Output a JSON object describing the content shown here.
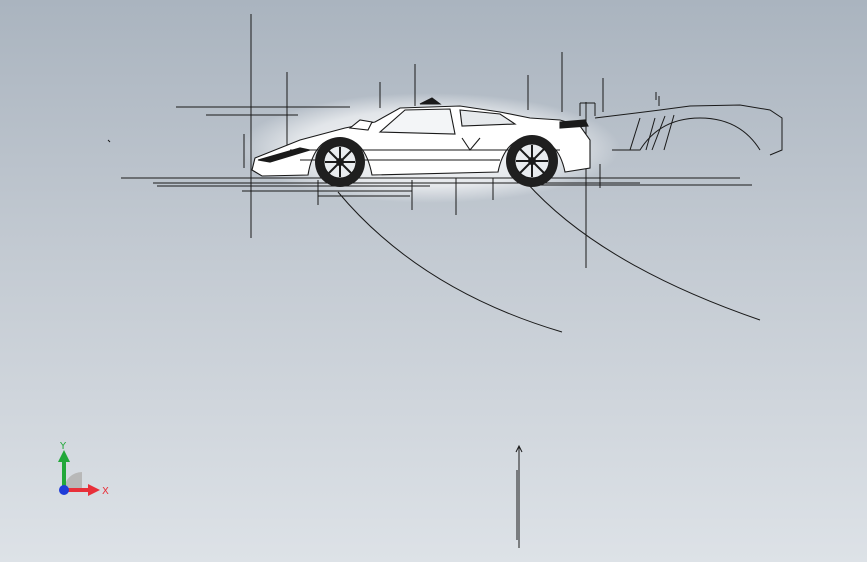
{
  "viewport": {
    "scene": "car-sketch",
    "background_top": "#aab4bf",
    "background_bottom": "#dde2e7"
  },
  "triad": {
    "x_label": "X",
    "y_label": "Y",
    "x_color": "#e8303a",
    "y_color": "#22a83a",
    "z_color": "#1e3cd8"
  }
}
